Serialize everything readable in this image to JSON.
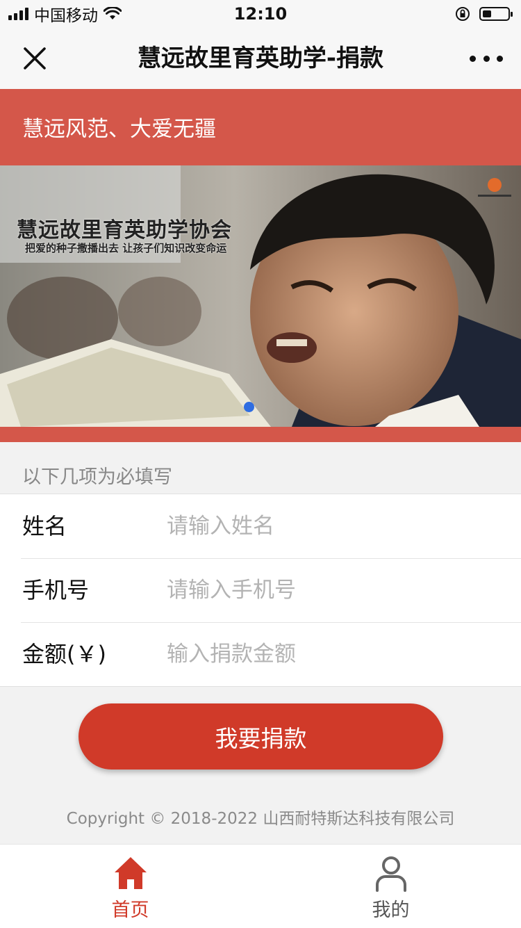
{
  "status_bar": {
    "carrier": "中国移动",
    "time": "12:10",
    "battery_level": 0.35
  },
  "nav": {
    "title": "慧远故里育英助学-捐款",
    "close_icon": "close-icon",
    "more_icon": "more-dots-icon"
  },
  "hero": {
    "slogan": "慧远风范、大爱无疆",
    "banner": {
      "title": "慧远故里育英助学协会",
      "subtitle": "把爱的种子撒播出去   让孩子们知识改变命运",
      "active_dot": 1,
      "dot_count": 1
    }
  },
  "form": {
    "hint": "以下几项为必填写",
    "fields": [
      {
        "label": "姓名",
        "placeholder": "请输入姓名",
        "value": ""
      },
      {
        "label": "手机号",
        "placeholder": "请输入手机号",
        "value": ""
      },
      {
        "label": "金额(￥)",
        "placeholder": "输入捐款金额",
        "value": ""
      }
    ],
    "submit_label": "我要捐款"
  },
  "footer": {
    "copyright": "Copyright © 2018-2022 山西耐特斯达科技有限公司"
  },
  "tabbar": {
    "items": [
      {
        "label": "首页",
        "icon": "home-icon",
        "active": true
      },
      {
        "label": "我的",
        "icon": "user-icon",
        "active": false
      }
    ]
  },
  "colors": {
    "accent": "#d03a29",
    "hero_bg": "#d4574a",
    "page_bg": "#f2f2f2",
    "dot": "#2f6de1"
  }
}
